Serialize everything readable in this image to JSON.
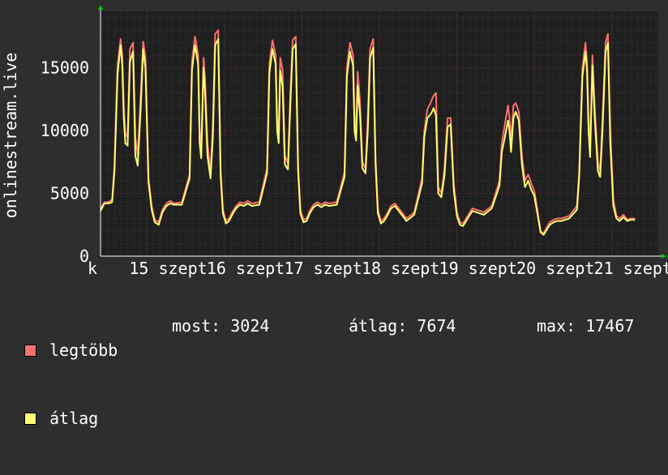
{
  "colors": {
    "background": "#2e2e2e",
    "plot_bg": "#1f1f1f",
    "grid_minor": "#3a3a3a",
    "grid_major": "#5a2a2a",
    "axis_arrow": "#00cc00",
    "series_max": "#ff7070",
    "series_avg": "#ffff70"
  },
  "chart_data": {
    "type": "line",
    "ylabel": "onlinestream.live",
    "ylim": [
      0,
      19500
    ],
    "yticks": [
      0,
      5000,
      10000,
      15000
    ],
    "xlim": [
      14.4,
      21.6
    ],
    "xticks": [
      {
        "x": 14.4,
        "label": "k"
      },
      {
        "x": 15,
        "label": "15 szept"
      },
      {
        "x": 16,
        "label": "16 szept"
      },
      {
        "x": 17,
        "label": "17 szept"
      },
      {
        "x": 18,
        "label": "18 szept"
      },
      {
        "x": 19,
        "label": "19 szept"
      },
      {
        "x": 20,
        "label": "20 szept"
      },
      {
        "x": 21,
        "label": "21 szept"
      }
    ],
    "grid": true,
    "legend_position": "bottom-left",
    "x": [
      14.4,
      14.45,
      14.5,
      14.55,
      14.58,
      14.62,
      14.66,
      14.68,
      14.7,
      14.72,
      14.75,
      14.78,
      14.82,
      14.85,
      14.88,
      14.92,
      14.95,
      14.98,
      15.02,
      15.06,
      15.1,
      15.15,
      15.2,
      15.25,
      15.3,
      15.35,
      15.45,
      15.55,
      15.58,
      15.62,
      15.66,
      15.68,
      15.7,
      15.73,
      15.75,
      15.78,
      15.82,
      15.85,
      15.88,
      15.92,
      15.95,
      15.98,
      16.02,
      16.06,
      16.1,
      16.15,
      16.2,
      16.25,
      16.3,
      16.35,
      16.45,
      16.55,
      16.58,
      16.62,
      16.66,
      16.68,
      16.7,
      16.72,
      16.75,
      16.78,
      16.82,
      16.85,
      16.88,
      16.92,
      16.95,
      16.98,
      17.02,
      17.06,
      17.1,
      17.15,
      17.2,
      17.25,
      17.3,
      17.35,
      17.45,
      17.55,
      17.58,
      17.62,
      17.66,
      17.68,
      17.7,
      17.72,
      17.75,
      17.78,
      17.82,
      17.85,
      17.88,
      17.92,
      17.95,
      17.98,
      18.02,
      18.06,
      18.1,
      18.15,
      18.2,
      18.25,
      18.3,
      18.35,
      18.45,
      18.55,
      18.58,
      18.62,
      18.66,
      18.68,
      18.7,
      18.73,
      18.76,
      18.8,
      18.84,
      18.88,
      18.92,
      18.96,
      19.0,
      19.04,
      19.08,
      19.12,
      19.16,
      19.2,
      19.25,
      19.3,
      19.35,
      19.45,
      19.55,
      19.58,
      19.62,
      19.66,
      19.68,
      19.7,
      19.73,
      19.76,
      19.8,
      19.84,
      19.88,
      19.92,
      19.96,
      20.0,
      20.04,
      20.08,
      20.12,
      20.16,
      20.2,
      20.25,
      20.3,
      20.35,
      20.45,
      20.55,
      20.58,
      20.62,
      20.66,
      20.68,
      20.7,
      20.72,
      20.75,
      20.78,
      20.82,
      20.85,
      20.88,
      20.92,
      20.95,
      20.98,
      21.02,
      21.06,
      21.1,
      21.15,
      21.2,
      21.25,
      21.3,
      21.35,
      21.45,
      21.5,
      21.55
    ],
    "series": [
      {
        "name": "legtöbb",
        "color": "#ff7070",
        "values": [
          3800,
          4300,
          4300,
          4500,
          7200,
          15200,
          17300,
          16000,
          12000,
          9800,
          9500,
          16500,
          17000,
          9500,
          8000,
          13000,
          17100,
          15800,
          6200,
          4000,
          2900,
          2700,
          3700,
          4200,
          4400,
          4200,
          4300,
          6500,
          15500,
          17500,
          16000,
          10000,
          8500,
          15800,
          14000,
          9000,
          6800,
          10500,
          17700,
          18000,
          7000,
          3700,
          2800,
          3000,
          3500,
          4000,
          4300,
          4200,
          4400,
          4200,
          4300,
          7000,
          15300,
          17200,
          16000,
          11000,
          9800,
          15800,
          14800,
          8000,
          7400,
          12800,
          17200,
          17500,
          7400,
          3700,
          2900,
          3000,
          3600,
          4100,
          4300,
          4100,
          4300,
          4200,
          4300,
          6700,
          15000,
          17000,
          16000,
          11000,
          10000,
          14700,
          12300,
          7500,
          7000,
          11000,
          16500,
          17300,
          8000,
          3700,
          2800,
          3000,
          3400,
          4000,
          4200,
          3800,
          3400,
          3000,
          3500,
          6200,
          10000,
          11700,
          12200,
          12500,
          12800,
          13000,
          5500,
          5000,
          7000,
          11000,
          11000,
          5800,
          3500,
          2700,
          2600,
          3000,
          3400,
          3800,
          3700,
          3600,
          3500,
          4000,
          6000,
          9000,
          10500,
          12000,
          11000,
          9000,
          12000,
          12200,
          11500,
          8000,
          6000,
          6500,
          5800,
          5200,
          3700,
          2000,
          1800,
          2300,
          2700,
          2900,
          3000,
          3000,
          3200,
          4000,
          6800,
          15000,
          17000,
          15500,
          11000,
          8500,
          16000,
          12000,
          7500,
          6800,
          11000,
          17000,
          17700,
          10000,
          4500,
          3200,
          3000,
          3300,
          2900,
          3000,
          3000
        ]
      },
      {
        "name": "átlag",
        "color": "#ffff70",
        "values": [
          3600,
          4200,
          4200,
          4300,
          6800,
          14500,
          16800,
          15200,
          11000,
          9000,
          8800,
          15500,
          16300,
          8000,
          7200,
          12000,
          16500,
          15000,
          5900,
          3700,
          2700,
          2500,
          3500,
          4000,
          4200,
          4100,
          4100,
          6200,
          14800,
          16800,
          15300,
          9000,
          7800,
          15000,
          13000,
          8000,
          6200,
          9500,
          16800,
          17300,
          6400,
          3400,
          2600,
          2800,
          3300,
          3800,
          4100,
          4000,
          4200,
          4000,
          4100,
          6600,
          14600,
          16500,
          15300,
          10000,
          9000,
          14800,
          13500,
          7300,
          6900,
          12000,
          16500,
          16900,
          6800,
          3400,
          2700,
          2800,
          3400,
          3900,
          4100,
          3900,
          4100,
          4000,
          4100,
          6300,
          14300,
          16300,
          15200,
          10000,
          9200,
          13600,
          11300,
          7000,
          6600,
          10000,
          15800,
          16600,
          7400,
          3400,
          2600,
          2800,
          3200,
          3800,
          4000,
          3600,
          3200,
          2800,
          3300,
          5800,
          9500,
          11000,
          11300,
          11500,
          11800,
          11200,
          5000,
          4700,
          6400,
          10300,
          10500,
          5300,
          3200,
          2500,
          2400,
          2800,
          3200,
          3600,
          3500,
          3400,
          3300,
          3800,
          5600,
          8300,
          9500,
          10800,
          10000,
          8300,
          11000,
          11500,
          10800,
          7300,
          5500,
          6000,
          5300,
          4800,
          3400,
          1900,
          1700,
          2100,
          2500,
          2700,
          2800,
          2800,
          3000,
          3700,
          6400,
          14300,
          16300,
          14800,
          10000,
          7900,
          15200,
          11000,
          6800,
          6300,
          10000,
          16300,
          17000,
          9000,
          4000,
          3000,
          2800,
          3100,
          2800,
          2900,
          2900
        ]
      }
    ]
  },
  "legend": {
    "max_label": "legtöbb",
    "avg_label": "átlag"
  },
  "stats": {
    "now_label": "most:",
    "now_value": "3024",
    "avg_label": "átlag:",
    "avg_value": "7674",
    "max_label": "max:",
    "max_value": "17467"
  }
}
